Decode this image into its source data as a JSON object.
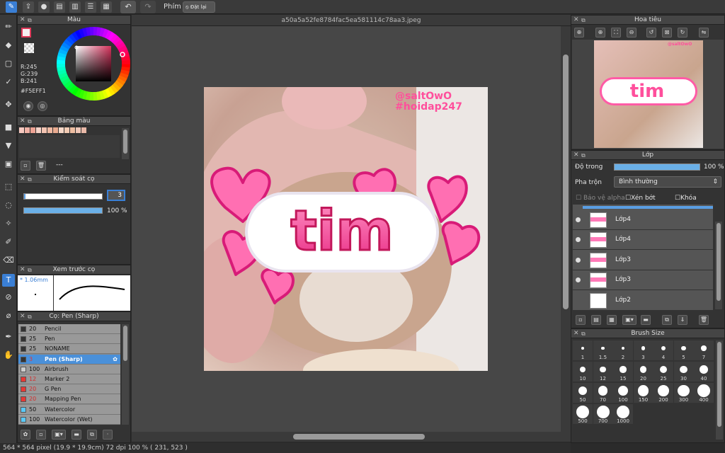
{
  "toolbar": {
    "phim_label": "Phím",
    "reset_label": "Đặt lại"
  },
  "document": {
    "tab_title": "a50a5a52fe8784fac5ea581114c78aa3.jpeg"
  },
  "status": {
    "text": "564 * 564 pixel   (19.9 * 19.9cm)   72 dpi   100 %   ( 231, 523 )"
  },
  "color_panel": {
    "title": "Màu",
    "r": "R:245",
    "g": "G:239",
    "b": "B:241",
    "hex": "#F5EFF1",
    "foreground": "#F5EFF1"
  },
  "palette_panel": {
    "title": "Bảng màu",
    "colors": [
      "#f7c9c0",
      "#f2b2a6",
      "#eea394",
      "#f6d3c8",
      "#f3c4b2",
      "#efb9a2",
      "#e9ab90",
      "#f6d8c8",
      "#f2cbb4",
      "#eebea2",
      "#efc7b8",
      "#e9b9a8"
    ],
    "dash": "---"
  },
  "brush_control": {
    "title": "Kiểm soát cọ",
    "size_value": "3",
    "opacity_value": "100 %",
    "size_level": 0.02,
    "opacity_level": 1.0
  },
  "brush_preview": {
    "title": "Xem trước cọ",
    "size": "* 1.06mm"
  },
  "brush_list": {
    "title": "Cọ: Pen (Sharp)",
    "items": [
      {
        "size": "20",
        "name": "Pencil",
        "color": "#333333"
      },
      {
        "size": "25",
        "name": "Pen",
        "color": "#333333"
      },
      {
        "size": "25",
        "name": "NONAME",
        "color": "#333333"
      },
      {
        "size": "3",
        "name": "Pen (Sharp)",
        "color": "#333333",
        "selected": true
      },
      {
        "size": "100",
        "name": "Airbrush",
        "color": "#cccccc"
      },
      {
        "size": "12",
        "name": "Marker 2",
        "color": "#e53935"
      },
      {
        "size": "20",
        "name": "G Pen",
        "color": "#e53935"
      },
      {
        "size": "20",
        "name": "Mapping Pen",
        "color": "#e53935"
      },
      {
        "size": "50",
        "name": "Watercolor",
        "color": "#5bc8f5"
      },
      {
        "size": "100",
        "name": "Watercolor (Wet)",
        "color": "#5bc8f5"
      }
    ]
  },
  "navigator": {
    "title": "Hoa tiêu"
  },
  "artwork": {
    "watermark_1": "@saltOwO",
    "watermark_2": "#hoidap247",
    "sticker_text": "tim"
  },
  "layers": {
    "title": "Lớp",
    "opacity_label": "Độ trong",
    "opacity_value": "100 %",
    "opacity_level": 1.0,
    "blend_label": "Pha trộn",
    "blend_value": "Bình thường",
    "protect_alpha": "Bảo vệ alpha",
    "clipping": "Xén bớt",
    "lock": "Khóa",
    "items": [
      {
        "name": "Lớp4"
      },
      {
        "name": "Lớp4"
      },
      {
        "name": "Lớp3"
      },
      {
        "name": "Lớp3"
      },
      {
        "name": "Lớp2"
      }
    ]
  },
  "brush_size": {
    "title": "Brush Size",
    "sizes": [
      "1",
      "1.5",
      "2",
      "3",
      "4",
      "5",
      "7",
      "10",
      "12",
      "15",
      "20",
      "25",
      "30",
      "40",
      "50",
      "70",
      "100",
      "150",
      "200",
      "300",
      "400",
      "500",
      "700",
      "1000"
    ]
  }
}
